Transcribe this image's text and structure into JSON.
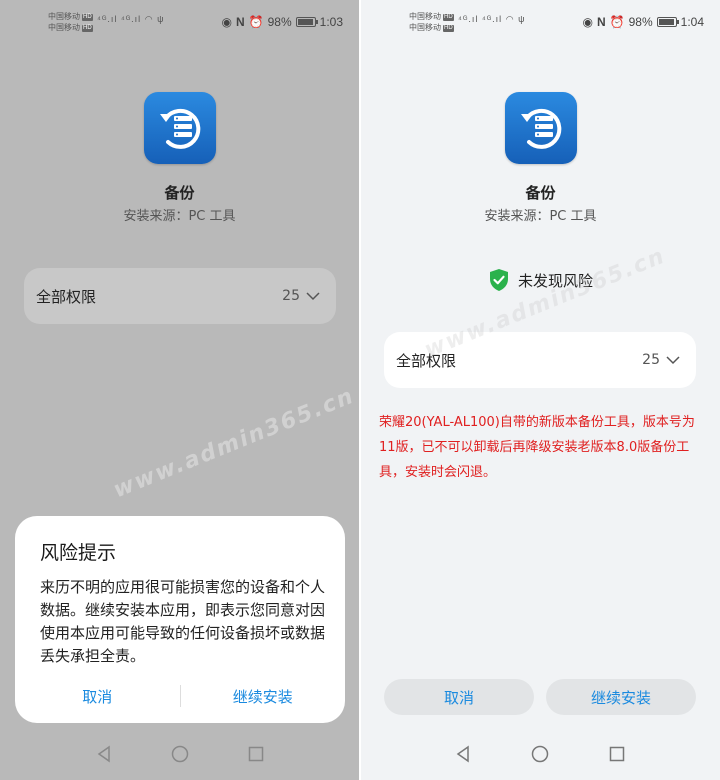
{
  "status_left": {
    "carrier1": "中国移动",
    "carrier2": "中国移动",
    "hd": "HD",
    "signal": "⁴ᴳ.ıl ⁴ᴳ.ıl",
    "battery": "98%",
    "time": "1:03"
  },
  "status_right": {
    "carrier1": "中国移动",
    "carrier2": "中国移动",
    "hd": "HD",
    "signal": "⁴ᴳ.ıl ⁴ᴳ.ıl",
    "battery": "98%",
    "time": "1:04"
  },
  "app": {
    "name": "备份",
    "source": "安装来源：PC 工具"
  },
  "permissions": {
    "label": "全部权限",
    "count": "25"
  },
  "dialog": {
    "title": "风险提示",
    "body": "来历不明的应用很可能损害您的设备和个人数据。继续安装本应用，即表示您同意对因使用本应用可能导致的任何设备损坏或数据丢失承担全责。",
    "cancel": "取消",
    "continue": "继续安装"
  },
  "safe_check": {
    "text": "未发现风险"
  },
  "note": "荣耀20(YAL-AL100)自带的新版本备份工具，版本号为11版，已不可以卸载后再降级安装老版本8.0版备份工具，安装时会闪退。",
  "buttons": {
    "cancel": "取消",
    "continue": "继续安装"
  },
  "watermark": "www.admin365.cn",
  "colors": {
    "accent": "#1a8adf",
    "note_red": "#e02020",
    "safe_green": "#2bb24c"
  }
}
